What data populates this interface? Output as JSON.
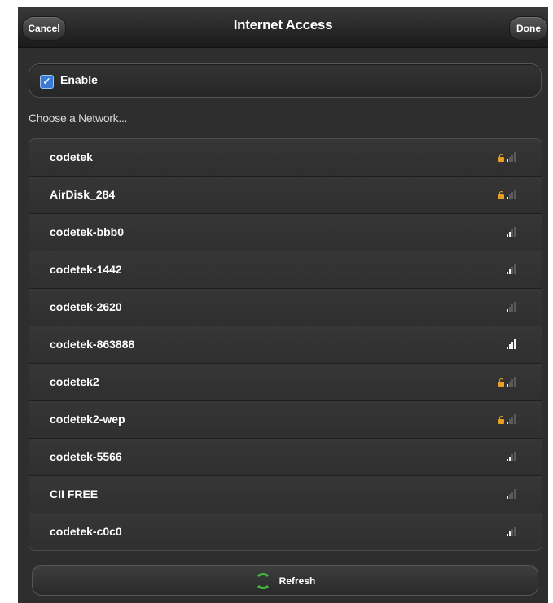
{
  "header": {
    "cancel_label": "Cancel",
    "title": "Internet Access",
    "done_label": "Done"
  },
  "enable": {
    "label": "Enable",
    "checked": true
  },
  "section_label": "Choose a Network...",
  "networks": [
    {
      "name": "codetek",
      "secured": true,
      "signal": 1
    },
    {
      "name": "AirDisk_284",
      "secured": true,
      "signal": 1
    },
    {
      "name": "codetek-bbb0",
      "secured": false,
      "signal": 2
    },
    {
      "name": "codetek-1442",
      "secured": false,
      "signal": 2
    },
    {
      "name": "codetek-2620",
      "secured": false,
      "signal": 1
    },
    {
      "name": "codetek-863888",
      "secured": false,
      "signal": 4
    },
    {
      "name": "codetek2",
      "secured": true,
      "signal": 1
    },
    {
      "name": "codetek2-wep",
      "secured": true,
      "signal": 1
    },
    {
      "name": "codetek-5566",
      "secured": false,
      "signal": 2
    },
    {
      "name": "CII FREE",
      "secured": false,
      "signal": 1
    },
    {
      "name": "codetek-c0c0",
      "secured": false,
      "signal": 2
    }
  ],
  "refresh_label": "Refresh",
  "colors": {
    "accent": "#3a7bd5",
    "lock": "#e8a020",
    "refresh_icon": "#45b83c"
  },
  "icons": {
    "checkbox": "checkmark-icon",
    "lock": "lock-icon",
    "signal": "wifi-signal-icon",
    "refresh": "refresh-icon"
  }
}
